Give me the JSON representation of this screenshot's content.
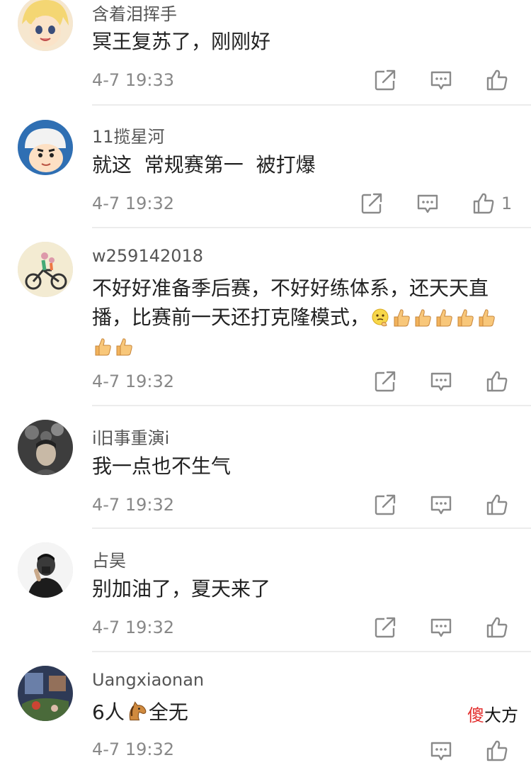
{
  "comments": [
    {
      "username": "含着泪挥手",
      "text": "冥王复苏了，刚刚好",
      "time": "4-7 19:33",
      "likes": ""
    },
    {
      "username": "11揽星河",
      "text": "就这  常规赛第一  被打爆",
      "time": "4-7 19:32",
      "likes": "1"
    },
    {
      "username": "w259142018",
      "text": "不好好准备季后赛，不好好练体系，还天天直播，比赛前一天还打克隆模式，",
      "time": "4-7 19:32",
      "likes": ""
    },
    {
      "username": "i旧事重演i",
      "text": "我一点也不生气",
      "time": "4-7 19:32",
      "likes": ""
    },
    {
      "username": "占昊",
      "text": "别加油了，夏天来了",
      "time": "4-7 19:32",
      "likes": ""
    },
    {
      "username": "Uangxiaonan",
      "text_before": "6人",
      "text_after": "全无",
      "time": "4-7 19:32",
      "likes": ""
    }
  ],
  "icons": {
    "share": "share-icon",
    "comment": "comment-icon",
    "like": "thumbs-up-icon",
    "thumbs_emoji": "thumbs-up-emoji",
    "thinking_emoji": "thinking-emoji",
    "horse_emoji": "horse-emoji"
  },
  "watermark": {
    "first": "傻",
    "rest": "大方"
  },
  "colors": {
    "text": "#222222",
    "meta": "#888888",
    "divider": "#ececec",
    "watermark_accent": "#e3302f"
  }
}
